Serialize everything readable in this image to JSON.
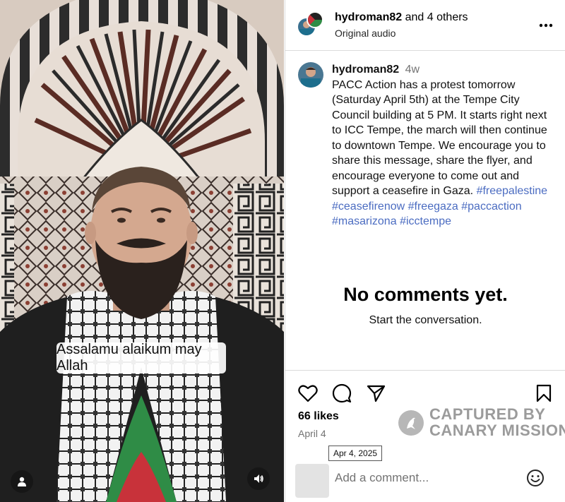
{
  "video": {
    "caption": "Assalamu alaikum may Allah",
    "icons": {
      "user_tag": "person-icon",
      "volume": "volume-icon"
    }
  },
  "header": {
    "username": "hydroman82",
    "collab_suffix": " and 4 others",
    "audio_label": "Original audio",
    "more_icon": "more-horizontal-icon"
  },
  "post": {
    "username": "hydroman82",
    "age": "4w",
    "text": "PACC Action has a protest tomorrow (Saturday April 5th) at the Tempe City Council building at 5 PM. It starts right next to ICC Tempe, the march will then continue to downtown Tempe. We encourage you to share this message, share the flyer, and encourage everyone to come out and support a ceasefire in Gaza. ",
    "hashtags": [
      "#freepalestine",
      "#ceasefirenow",
      "#freegaza",
      "#paccaction",
      "#masarizona",
      "#icctempe"
    ]
  },
  "comments": {
    "empty_title": "No comments yet.",
    "empty_subtitle": "Start the conversation."
  },
  "actions": {
    "icons": [
      "heart-icon",
      "comment-icon",
      "share-icon",
      "bookmark-icon"
    ]
  },
  "stats": {
    "likes": "66 likes",
    "date": "April 4",
    "date_tooltip": "Apr 4, 2025"
  },
  "watermark": {
    "line1": "CAPTURED BY",
    "line2": "CANARY MISSION"
  },
  "comment_box": {
    "placeholder": "Add a comment...",
    "emoji_icon": "smiley-icon"
  },
  "colors": {
    "hashtag": "#4b6cc1",
    "muted": "#737373",
    "divider": "#dbdbdb"
  }
}
